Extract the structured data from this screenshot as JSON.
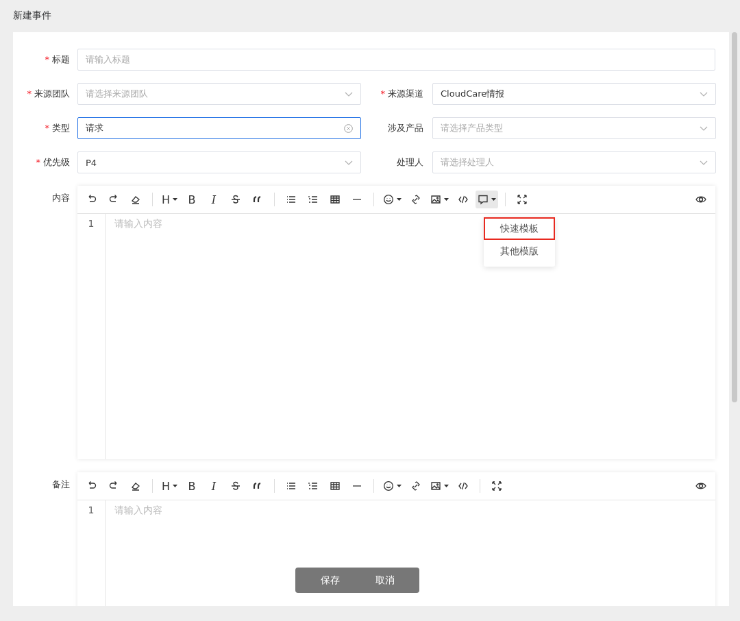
{
  "page_title": "新建事件",
  "form_rows": [
    [
      {
        "label": "标题",
        "required_mark": "*",
        "kind": "text",
        "placeholder": "请输入标题"
      }
    ],
    [
      {
        "label": "来源团队",
        "required_mark": "*",
        "kind": "select",
        "placeholder": "请选择来源团队"
      },
      {
        "label": "来源渠道",
        "required_mark": "*",
        "kind": "select",
        "value": "CloudCare情报"
      }
    ],
    [
      {
        "label": "类型",
        "required_mark": "*",
        "kind": "clearable",
        "value": "请求",
        "focused": true
      },
      {
        "label": "涉及产品",
        "kind": "select",
        "placeholder": "请选择产品类型"
      }
    ],
    [
      {
        "label": "优先级",
        "required_mark": "*",
        "kind": "select",
        "value": "P4"
      },
      {
        "label": "处理人",
        "kind": "select",
        "placeholder": "请选择处理人"
      }
    ]
  ],
  "editors": [
    {
      "label": "内容",
      "line_number": "1",
      "placeholder": "请输入内容",
      "toolbar": [
        {
          "kind": "undo"
        },
        {
          "kind": "redo"
        },
        {
          "kind": "eraser"
        },
        {
          "kind": "divider"
        },
        {
          "kind": "heading",
          "text": "H",
          "caret": true
        },
        {
          "kind": "bold",
          "text": "B"
        },
        {
          "kind": "italic",
          "text": "I"
        },
        {
          "kind": "strike"
        },
        {
          "kind": "quote"
        },
        {
          "kind": "divider"
        },
        {
          "kind": "ul"
        },
        {
          "kind": "ol"
        },
        {
          "kind": "table"
        },
        {
          "kind": "hr"
        },
        {
          "kind": "divider"
        },
        {
          "kind": "emoji",
          "caret": true
        },
        {
          "kind": "link"
        },
        {
          "kind": "image",
          "caret": true
        },
        {
          "kind": "code"
        },
        {
          "kind": "comment",
          "caret": true,
          "active": true
        },
        {
          "kind": "divider"
        },
        {
          "kind": "fullscreen"
        },
        {
          "kind": "preview"
        }
      ],
      "menu": [
        {
          "label": "快速模板",
          "selected": true
        },
        {
          "label": "其他模版",
          "selected": false
        }
      ]
    },
    {
      "label": "备注",
      "line_number": "1",
      "placeholder": "请输入内容",
      "toolbar": [
        {
          "kind": "undo"
        },
        {
          "kind": "redo"
        },
        {
          "kind": "eraser"
        },
        {
          "kind": "divider"
        },
        {
          "kind": "heading",
          "text": "H",
          "caret": true
        },
        {
          "kind": "bold",
          "text": "B"
        },
        {
          "kind": "italic",
          "text": "I"
        },
        {
          "kind": "strike"
        },
        {
          "kind": "quote"
        },
        {
          "kind": "divider"
        },
        {
          "kind": "ul"
        },
        {
          "kind": "ol"
        },
        {
          "kind": "table"
        },
        {
          "kind": "hr"
        },
        {
          "kind": "divider"
        },
        {
          "kind": "emoji",
          "caret": true
        },
        {
          "kind": "link"
        },
        {
          "kind": "image",
          "caret": true
        },
        {
          "kind": "code"
        },
        {
          "kind": "divider"
        },
        {
          "kind": "fullscreen"
        },
        {
          "kind": "preview"
        }
      ]
    }
  ],
  "actions": [
    {
      "label": "保存"
    },
    {
      "label": "取消"
    }
  ]
}
